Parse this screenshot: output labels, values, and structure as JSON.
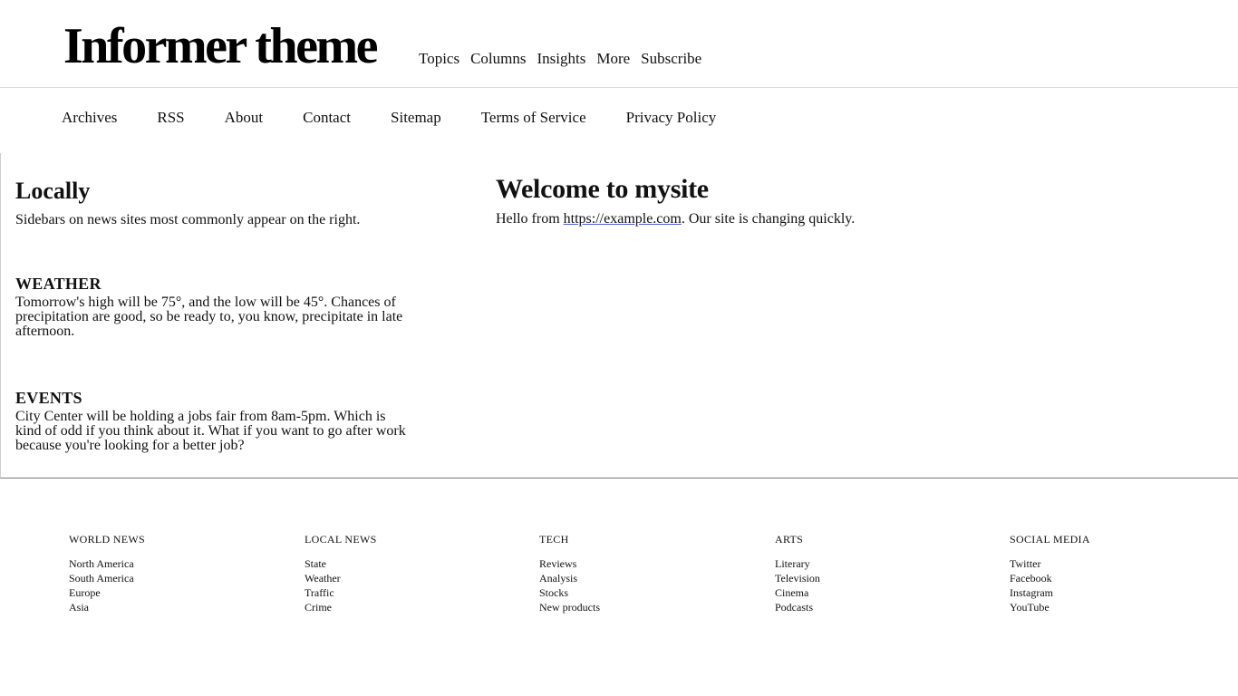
{
  "header": {
    "site_title": "Informer theme",
    "nav": [
      "Topics",
      "Columns",
      "Insights",
      "More",
      "Subscribe"
    ]
  },
  "sub_nav": [
    "Archives",
    "RSS",
    "About",
    "Contact",
    "Sitemap",
    "Terms of Service",
    "Privacy Policy"
  ],
  "sidebar": {
    "heading": "Locally",
    "intro": "Sidebars on news sites most commonly appear on the right.",
    "weather": {
      "heading": "WEATHER",
      "text": "Tomorrow's high will be 75°, and the low will be 45°. Chances of precipitation are good, so be ready to, you know, precipitate in late afternoon."
    },
    "events": {
      "heading": "EVENTS",
      "text": "City Center will be holding a jobs fair from 8am-5pm. Which is kind of odd if you think about it. What if you want to go after work because you're looking for a better job?"
    }
  },
  "main": {
    "heading": "Welcome to mysite",
    "text_before": "Hello from ",
    "link": "https://example.com",
    "text_after": ". Our site is changing quickly."
  },
  "footer": {
    "columns": [
      {
        "heading": "WORLD NEWS",
        "items": [
          "North America",
          "South America",
          "Europe",
          "Asia"
        ]
      },
      {
        "heading": "LOCAL NEWS",
        "items": [
          "State",
          "Weather",
          "Traffic",
          "Crime"
        ]
      },
      {
        "heading": "TECH",
        "items": [
          "Reviews",
          "Analysis",
          "Stocks",
          "New products"
        ]
      },
      {
        "heading": "ARTS",
        "items": [
          "Literary",
          "Television",
          "Cinema",
          "Podcasts"
        ]
      },
      {
        "heading": "SOCIAL MEDIA",
        "items": [
          "Twitter",
          "Facebook",
          "Instagram",
          "YouTube"
        ]
      }
    ]
  }
}
